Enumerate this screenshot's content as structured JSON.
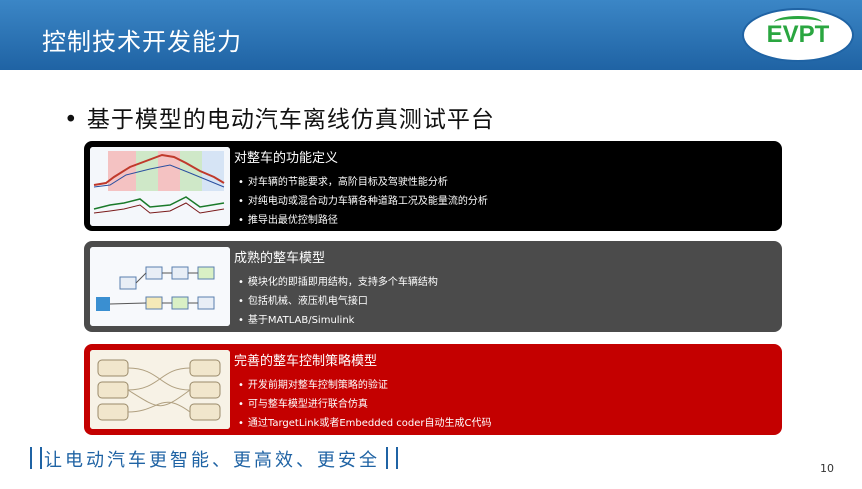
{
  "header": {
    "title": "控制技术开发能力",
    "logo_text": "EVPT"
  },
  "headline": "• 基于模型的电动汽车离线仿真测试平台",
  "panels": [
    {
      "title": "对整车的功能定义",
      "bullets": [
        "对车辆的节能要求，高阶目标及驾驶性能分析",
        "对纯电动或混合动力车辆各种道路工况及能量流的分析",
        "推导出最优控制路径"
      ]
    },
    {
      "title": "成熟的整车模型",
      "bullets": [
        "模块化的即插即用结构，支持多个车辆结构",
        "包括机械、液压机电气接口",
        "基于MATLAB/Simulink"
      ]
    },
    {
      "title": "完善的整车控制策略模型",
      "bullets": [
        "开发前期对整车控制策略的验证",
        "可与整车模型进行联合仿真",
        "通过TargetLink或者Embedded coder自动生成C代码"
      ]
    }
  ],
  "slogan": "让电动汽车更智能、更高效、更安全",
  "page_number": "10",
  "colors": {
    "header": "#1f63a4",
    "panel1": "#000000",
    "panel2": "#4b4b4b",
    "panel3": "#c40000",
    "logo": "#2aa640"
  }
}
